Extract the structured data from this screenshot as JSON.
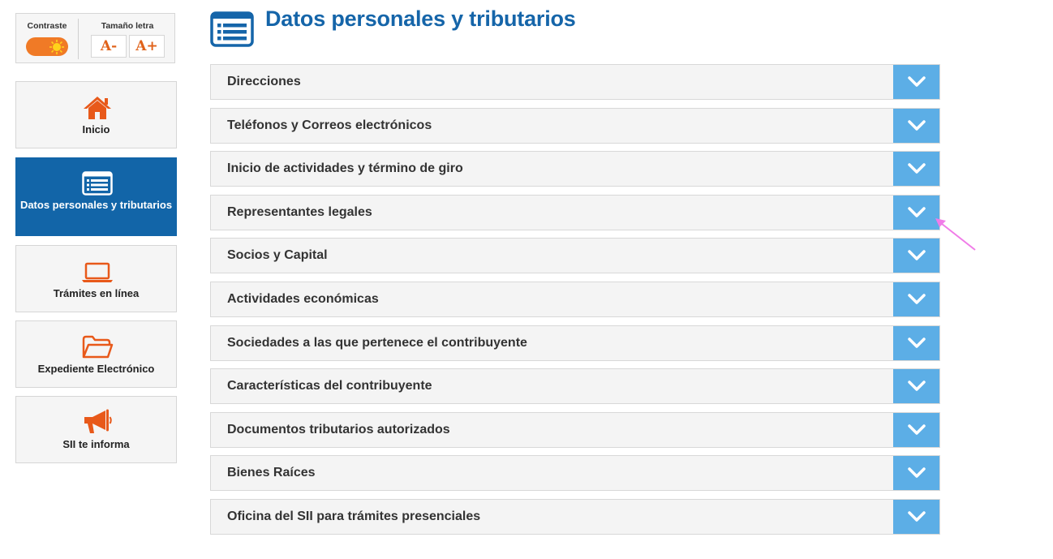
{
  "accessibility": {
    "contrast_label": "Contraste",
    "font_size_label": "Tamaño letra",
    "decrease_label": "A-",
    "increase_label": "A+",
    "toggle_color": "#f07a26"
  },
  "sidebar": {
    "items": [
      {
        "label": "Inicio",
        "icon": "home-icon",
        "active": false
      },
      {
        "label": "Datos personales y tributarios",
        "icon": "list-card-icon",
        "active": true
      },
      {
        "label": "Trámites en línea",
        "icon": "laptop-icon",
        "active": false
      },
      {
        "label": "Expediente Electrónico",
        "icon": "folder-icon",
        "active": false
      },
      {
        "label": "SII te informa",
        "icon": "megaphone-icon",
        "active": false
      }
    ]
  },
  "main": {
    "title": "Datos personales y tributarios",
    "title_icon": "list-card-icon",
    "sections": [
      {
        "label": "Direcciones"
      },
      {
        "label": "Teléfonos y Correos electrónicos"
      },
      {
        "label": "Inicio de actividades y término de giro"
      },
      {
        "label": "Representantes legales"
      },
      {
        "label": "Socios y Capital"
      },
      {
        "label": "Actividades económicas"
      },
      {
        "label": "Sociedades a las que pertenece el contribuyente"
      },
      {
        "label": "Características del contribuyente"
      },
      {
        "label": "Documentos tributarios autorizados"
      },
      {
        "label": "Bienes Raíces"
      },
      {
        "label": "Oficina del SII para trámites presenciales"
      }
    ]
  },
  "colors": {
    "brand_blue": "#1565a9",
    "active_nav": "#1265a8",
    "accent_orange": "#e0621a",
    "toggle_blue": "#5caee6",
    "pointer_pink": "#f07ce8"
  }
}
